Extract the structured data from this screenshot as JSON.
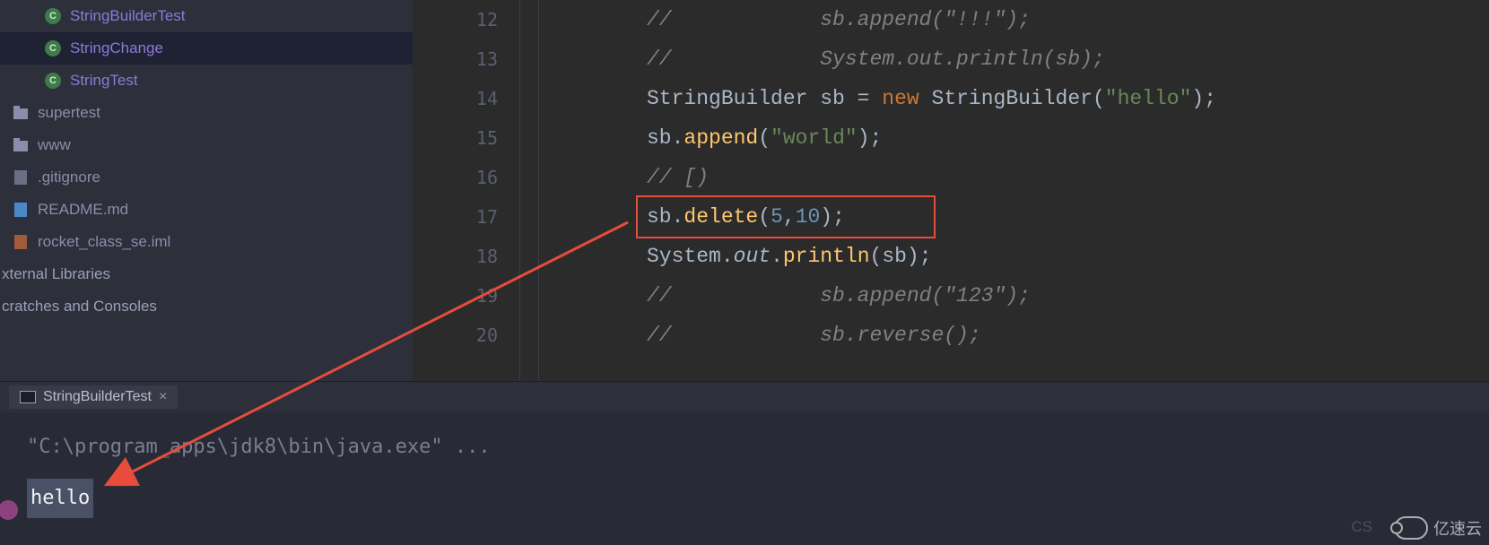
{
  "sidebar": {
    "items": [
      {
        "label": "StringBuilderTest",
        "kind": "class",
        "icon": "C"
      },
      {
        "label": "StringChange",
        "kind": "class",
        "icon": "C",
        "selected": true
      },
      {
        "label": "StringTest",
        "kind": "class",
        "icon": "C"
      },
      {
        "label": "supertest",
        "kind": "folder"
      },
      {
        "label": "www",
        "kind": "folder"
      },
      {
        "label": ".gitignore",
        "kind": "file"
      },
      {
        "label": "README.md",
        "kind": "md"
      },
      {
        "label": "rocket_class_se.iml",
        "kind": "iml"
      },
      {
        "label": "xternal Libraries",
        "kind": "group"
      },
      {
        "label": "cratches and Consoles",
        "kind": "group"
      }
    ]
  },
  "editor": {
    "line_start": 12,
    "lines": [
      {
        "n": 12,
        "tokens": [
          [
            "//            sb.append(\"!!!\");",
            "comment"
          ]
        ]
      },
      {
        "n": 13,
        "tokens": [
          [
            "//            System.out.println(sb);",
            "comment"
          ]
        ]
      },
      {
        "n": 14,
        "tokens": [
          [
            "StringBuilder",
            "type"
          ],
          [
            " "
          ],
          [
            "sb",
            "var"
          ],
          [
            " = "
          ],
          [
            "new",
            "keyword"
          ],
          [
            " "
          ],
          [
            "StringBuilder",
            "type"
          ],
          [
            "("
          ],
          [
            "\"hello\"",
            "string"
          ],
          [
            ");"
          ]
        ]
      },
      {
        "n": 15,
        "tokens": [
          [
            "sb",
            "var"
          ],
          [
            "."
          ],
          [
            "append",
            "method"
          ],
          [
            "("
          ],
          [
            "\"world\"",
            "string"
          ],
          [
            ");"
          ]
        ]
      },
      {
        "n": 16,
        "tokens": [
          [
            "// [)",
            "comment"
          ]
        ]
      },
      {
        "n": 17,
        "tokens": [
          [
            "sb",
            "var"
          ],
          [
            "."
          ],
          [
            "delete",
            "method"
          ],
          [
            "("
          ],
          [
            "5",
            "num"
          ],
          [
            ","
          ],
          [
            "10",
            "num"
          ],
          [
            ");"
          ]
        ],
        "boxed": true
      },
      {
        "n": 18,
        "tokens": [
          [
            "System",
            "type"
          ],
          [
            "."
          ],
          [
            "out",
            "static"
          ],
          [
            "."
          ],
          [
            "println",
            "method"
          ],
          [
            "("
          ],
          [
            "sb",
            "var"
          ],
          [
            ");"
          ]
        ]
      },
      {
        "n": 19,
        "tokens": [
          [
            "//            sb.append(\"123\");",
            "comment"
          ]
        ],
        "wavy": true
      },
      {
        "n": 20,
        "tokens": [
          [
            "//            sb.reverse();",
            "comment"
          ]
        ]
      }
    ]
  },
  "run": {
    "tab_label": "StringBuilderTest",
    "command": "\"C:\\program_apps\\jdk8\\bin\\java.exe\" ...",
    "output_highlight": "hello"
  },
  "watermark": {
    "text": "亿速云",
    "cs": "CS"
  }
}
